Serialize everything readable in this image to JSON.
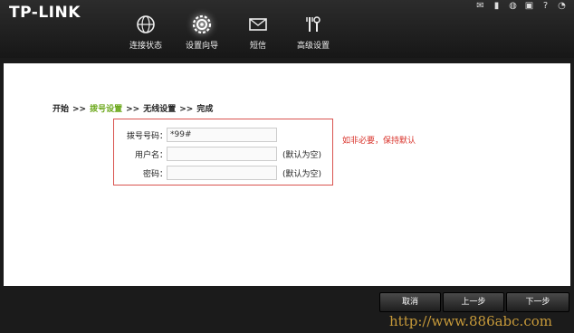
{
  "brand": {
    "logo": "TP-LINK"
  },
  "status_icons": [
    "mail-icon",
    "signal-icon",
    "globe-icon",
    "sim-icon",
    "help-icon",
    "wifi-icon"
  ],
  "nav": [
    {
      "label": "连接状态",
      "icon": "globe-icon"
    },
    {
      "label": "设置向导",
      "icon": "gear-icon"
    },
    {
      "label": "短信",
      "icon": "mail-icon"
    },
    {
      "label": "高级设置",
      "icon": "tools-icon"
    }
  ],
  "wizard": {
    "steps": [
      "开始",
      "拨号设置",
      "无线设置",
      "完成"
    ],
    "separator": ">>",
    "current_step": 1
  },
  "form": {
    "dial_label": "拨号号码：",
    "dial_value": "*99#",
    "username_label": "用户名：",
    "username_value": "",
    "username_note": "(默认为空)",
    "password_label": "密码：",
    "password_value": "",
    "password_note": "(默认为空)",
    "hint": "如非必要，保持默认"
  },
  "buttons": {
    "cancel": "取消",
    "prev": "上一步",
    "next": "下一步"
  },
  "watermark": "http://www.886abc.com",
  "colors": {
    "accent_green": "#6aa719",
    "alert_red": "#d9322a",
    "topbar": "#1f1f1f"
  }
}
